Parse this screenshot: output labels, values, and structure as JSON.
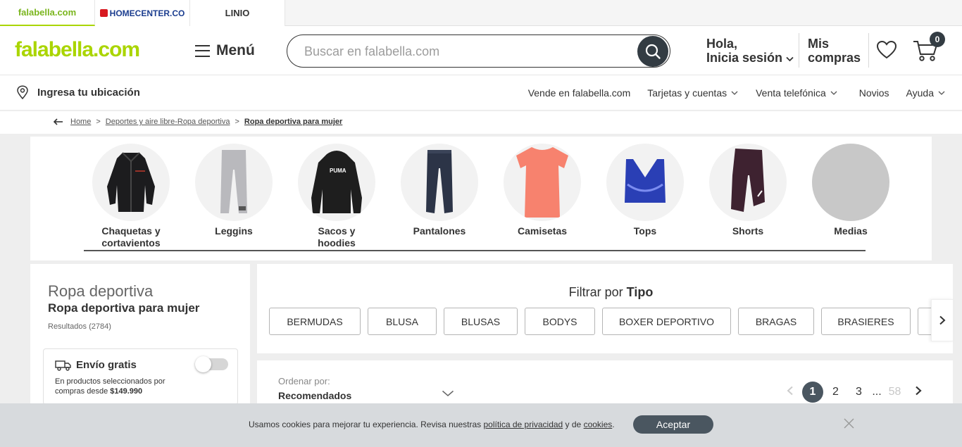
{
  "brand_tabs": [
    {
      "label": "falabella.com"
    },
    {
      "label": "HOMECENTER.CO"
    },
    {
      "label": "LINIO"
    }
  ],
  "header": {
    "logo": "falabella.com",
    "menu_label": "Menú",
    "search_placeholder": "Buscar en falabella.com",
    "login_line1": "Hola,",
    "login_line2": "Inicia sesión",
    "compras_line1": "Mis",
    "compras_line2": "compras",
    "cart_count": "0"
  },
  "subnav": {
    "location": "Ingresa tu ubicación",
    "links": [
      {
        "label": "Vende en falabella.com",
        "dropdown": false
      },
      {
        "label": "Tarjetas y cuentas",
        "dropdown": true
      },
      {
        "label": "Venta telefónica",
        "dropdown": true
      },
      {
        "label": "Novios",
        "dropdown": false
      },
      {
        "label": "Ayuda",
        "dropdown": true
      }
    ]
  },
  "breadcrumb": {
    "items": [
      "Home",
      "Deportes y aire libre-Ropa deportiva",
      "Ropa deportiva para mujer"
    ]
  },
  "categories": [
    {
      "label": "Chaquetas y cortavientos",
      "icon": "jacket-image"
    },
    {
      "label": "Leggins",
      "icon": "leggings-image"
    },
    {
      "label": "Sacos y hoodies",
      "icon": "hoodie-image"
    },
    {
      "label": "Pantalones",
      "icon": "pants-image"
    },
    {
      "label": "Camisetas",
      "icon": "tshirt-image"
    },
    {
      "label": "Tops",
      "icon": "sports-bra-image"
    },
    {
      "label": "Shorts",
      "icon": "shorts-image"
    },
    {
      "label": "Medias",
      "icon": "socks-placeholder"
    }
  ],
  "sidebar": {
    "title": "Ropa deportiva",
    "subtitle": "Ropa deportiva para mujer",
    "results": "Resultados (2784)",
    "envio": {
      "title": "Envío gratis",
      "desc_prefix": "En productos seleccionados por compras desde ",
      "desc_amount": "$149.990",
      "enabled": false
    }
  },
  "filter": {
    "title_prefix": "Filtrar por ",
    "title_bold": "Tipo",
    "chips": [
      "BERMUDAS",
      "BLUSA",
      "BLUSAS",
      "BODYS",
      "BOXER DEPORTIVO",
      "BRAGAS",
      "BRASIERES"
    ]
  },
  "sort": {
    "label": "Ordenar por:",
    "value": "Recomendados"
  },
  "pagination": {
    "current": "1",
    "pages": [
      "2",
      "3"
    ],
    "ellipsis": "...",
    "last": "58"
  },
  "cookie": {
    "text_1": "Usamos cookies para mejorar tu experiencia. Revisa nuestras ",
    "link_1": "política de privacidad",
    "text_2": " y de ",
    "link_2": "cookies",
    "text_3": ".",
    "accept": "Aceptar"
  },
  "colors": {
    "brand_green": "#aad500",
    "dark_button": "#333c43"
  }
}
